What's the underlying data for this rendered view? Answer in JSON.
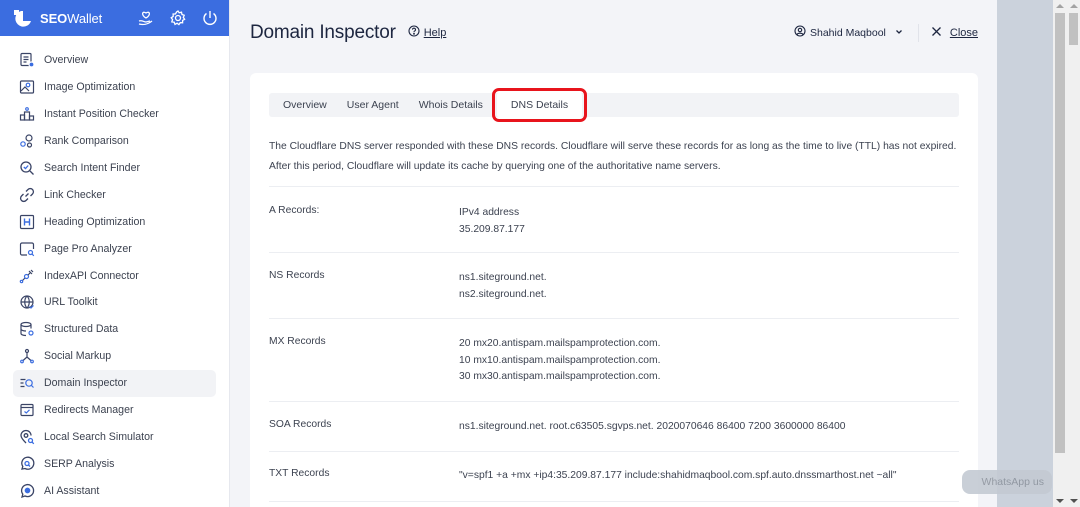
{
  "app": {
    "brand_bold": "SEO",
    "brand_rest": "Wallet",
    "brand_color": "#3b6de0",
    "header_icons": [
      "heart-hand-icon",
      "gear-icon",
      "power-icon"
    ]
  },
  "sidebar": {
    "items": [
      {
        "label": "Overview",
        "icon": "overview-icon"
      },
      {
        "label": "Image Optimization",
        "icon": "image-icon"
      },
      {
        "label": "Instant Position Checker",
        "icon": "podium-icon"
      },
      {
        "label": "Rank Comparison",
        "icon": "rank-compare-icon"
      },
      {
        "label": "Search Intent Finder",
        "icon": "search-check-icon"
      },
      {
        "label": "Link Checker",
        "icon": "link-icon"
      },
      {
        "label": "Heading Optimization",
        "icon": "heading-icon"
      },
      {
        "label": "Page Pro Analyzer",
        "icon": "page-analyzer-icon"
      },
      {
        "label": "IndexAPI Connector",
        "icon": "plug-icon"
      },
      {
        "label": "URL Toolkit",
        "icon": "globe-icon"
      },
      {
        "label": "Structured Data",
        "icon": "database-icon"
      },
      {
        "label": "Social Markup",
        "icon": "network-icon"
      },
      {
        "label": "Domain Inspector",
        "icon": "domain-search-icon",
        "active": true
      },
      {
        "label": "Redirects Manager",
        "icon": "calendar-check-icon"
      },
      {
        "label": "Local Search Simulator",
        "icon": "location-search-icon"
      },
      {
        "label": "SERP Analysis",
        "icon": "chat-search-icon"
      },
      {
        "label": "AI Assistant",
        "icon": "ai-chat-icon"
      }
    ]
  },
  "header": {
    "title": "Domain Inspector",
    "help_label": "Help",
    "user_name": "Shahid Maqbool",
    "close_label": "Close"
  },
  "tabs": [
    {
      "label": "Overview",
      "active": false
    },
    {
      "label": "User Agent",
      "active": false
    },
    {
      "label": "Whois Details",
      "active": false
    },
    {
      "label": "DNS Details",
      "active": true
    }
  ],
  "highlight_color": "#e8141c",
  "dns": {
    "description": "The Cloudflare DNS server responded with these DNS records. Cloudflare will serve these records for as long as the time to live (TTL) has not expired. After this period, Cloudflare will update its cache by querying one of the authoritative name servers.",
    "records": [
      {
        "label": "A Records:",
        "values": [
          "IPv4 address",
          "35.209.87.177"
        ]
      },
      {
        "label": "NS Records",
        "values": [
          "ns1.siteground.net.",
          "ns2.siteground.net."
        ]
      },
      {
        "label": "MX Records",
        "values": [
          "20 mx20.antispam.mailspamprotection.com.",
          "10 mx10.antispam.mailspamprotection.com.",
          "30 mx30.antispam.mailspamprotection.com."
        ]
      },
      {
        "label": "SOA Records",
        "values": [
          "ns1.siteground.net. root.c63505.sgvps.net. 2020070646 86400 7200 3600000 86400"
        ]
      },
      {
        "label": "TXT Records",
        "values": [
          "\"v=spf1 +a +mx +ip4:35.209.87.177 include:shahidmaqbool.com.spf.auto.dnssmarthost.net ~all\""
        ]
      }
    ]
  },
  "whatsapp_chip": "WhatsApp us"
}
